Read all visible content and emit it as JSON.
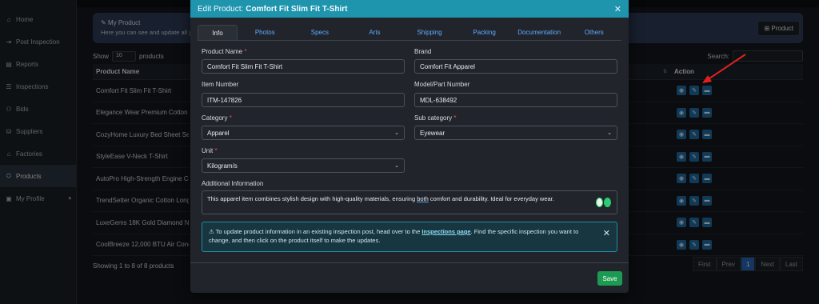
{
  "sidebar": {
    "items": [
      {
        "icon": "home-icon",
        "label": "Home"
      },
      {
        "icon": "post-icon",
        "label": "Post Inspection"
      },
      {
        "icon": "reports-icon",
        "label": "Reports"
      },
      {
        "icon": "inspections-icon",
        "label": "Inspections"
      },
      {
        "icon": "bids-icon",
        "label": "Bids"
      },
      {
        "icon": "suppliers-icon",
        "label": "Suppliers"
      },
      {
        "icon": "factories-icon",
        "label": "Factories"
      },
      {
        "icon": "products-icon",
        "label": "Products"
      },
      {
        "icon": "profile-icon",
        "label": "My Profile"
      }
    ]
  },
  "banner": {
    "title": "My Product",
    "subtitle": "Here you can see and update all y",
    "product_button": "Product"
  },
  "list_controls": {
    "show_label": "Show",
    "show_value": "10",
    "entries_label": "products",
    "search_label": "Search:"
  },
  "table": {
    "headers": {
      "name": "Product Name",
      "action": "Action"
    },
    "rows": [
      "Comfort Fit Slim Fit T-Shirt",
      "Elegance Wear Premium Cotton S",
      "CozyHome Luxury Bed Sheet Set",
      "StyleEase V-Neck T-Shirt",
      "AutoPro High-Strength Engine Co",
      "TrendSetter Organic Cotton Long",
      "LuxeGems 18K Gold Diamond Ne",
      "CoolBreeze 12,000 BTU Air Cond"
    ]
  },
  "footer": {
    "info": "Showing 1 to 8 of 8 products",
    "pager": [
      "First",
      "Prev",
      "1",
      "Next",
      "Last"
    ]
  },
  "modal": {
    "title_prefix": "Edit Product:",
    "title_product": "Comfort Fit Slim Fit T-Shirt",
    "tabs": [
      "Info",
      "Photos",
      "Specs",
      "Arts",
      "Shipping",
      "Packing",
      "Documentation",
      "Others"
    ],
    "fields": {
      "product_name": {
        "label": "Product Name",
        "value": "Comfort Fit Slim Fit T-Shirt"
      },
      "brand": {
        "label": "Brand",
        "value": "Comfort Fit Apparel"
      },
      "item_number": {
        "label": "Item Number",
        "value": "ITM-147826"
      },
      "model_number": {
        "label": "Model/Part Number",
        "value": "MDL-638492"
      },
      "category": {
        "label": "Category",
        "value": "Apparel"
      },
      "sub_category": {
        "label": "Sub category",
        "value": "Eyewear"
      },
      "unit": {
        "label": "Unit",
        "value": "Kilogram/s"
      },
      "additional_info": {
        "label": "Additional Information",
        "text_before": "This apparel item combines stylish design with high-quality materials, ensuring ",
        "text_underlined": "both",
        "text_after": " comfort and durability. Ideal for everyday wear."
      }
    },
    "alert": {
      "text_before": "To update product information in an existing inspection post, head over to the ",
      "link": "Inspections page",
      "text_after": ". Find the specific inspection you want to change, and then click on the product itself to make the updates."
    },
    "save_label": "Save"
  },
  "colors": {
    "header": "#1e94ad",
    "save": "#1d9a52",
    "action_button": "#1f6aa0",
    "pager_active": "#2563b0",
    "arrow": "#e02020"
  }
}
